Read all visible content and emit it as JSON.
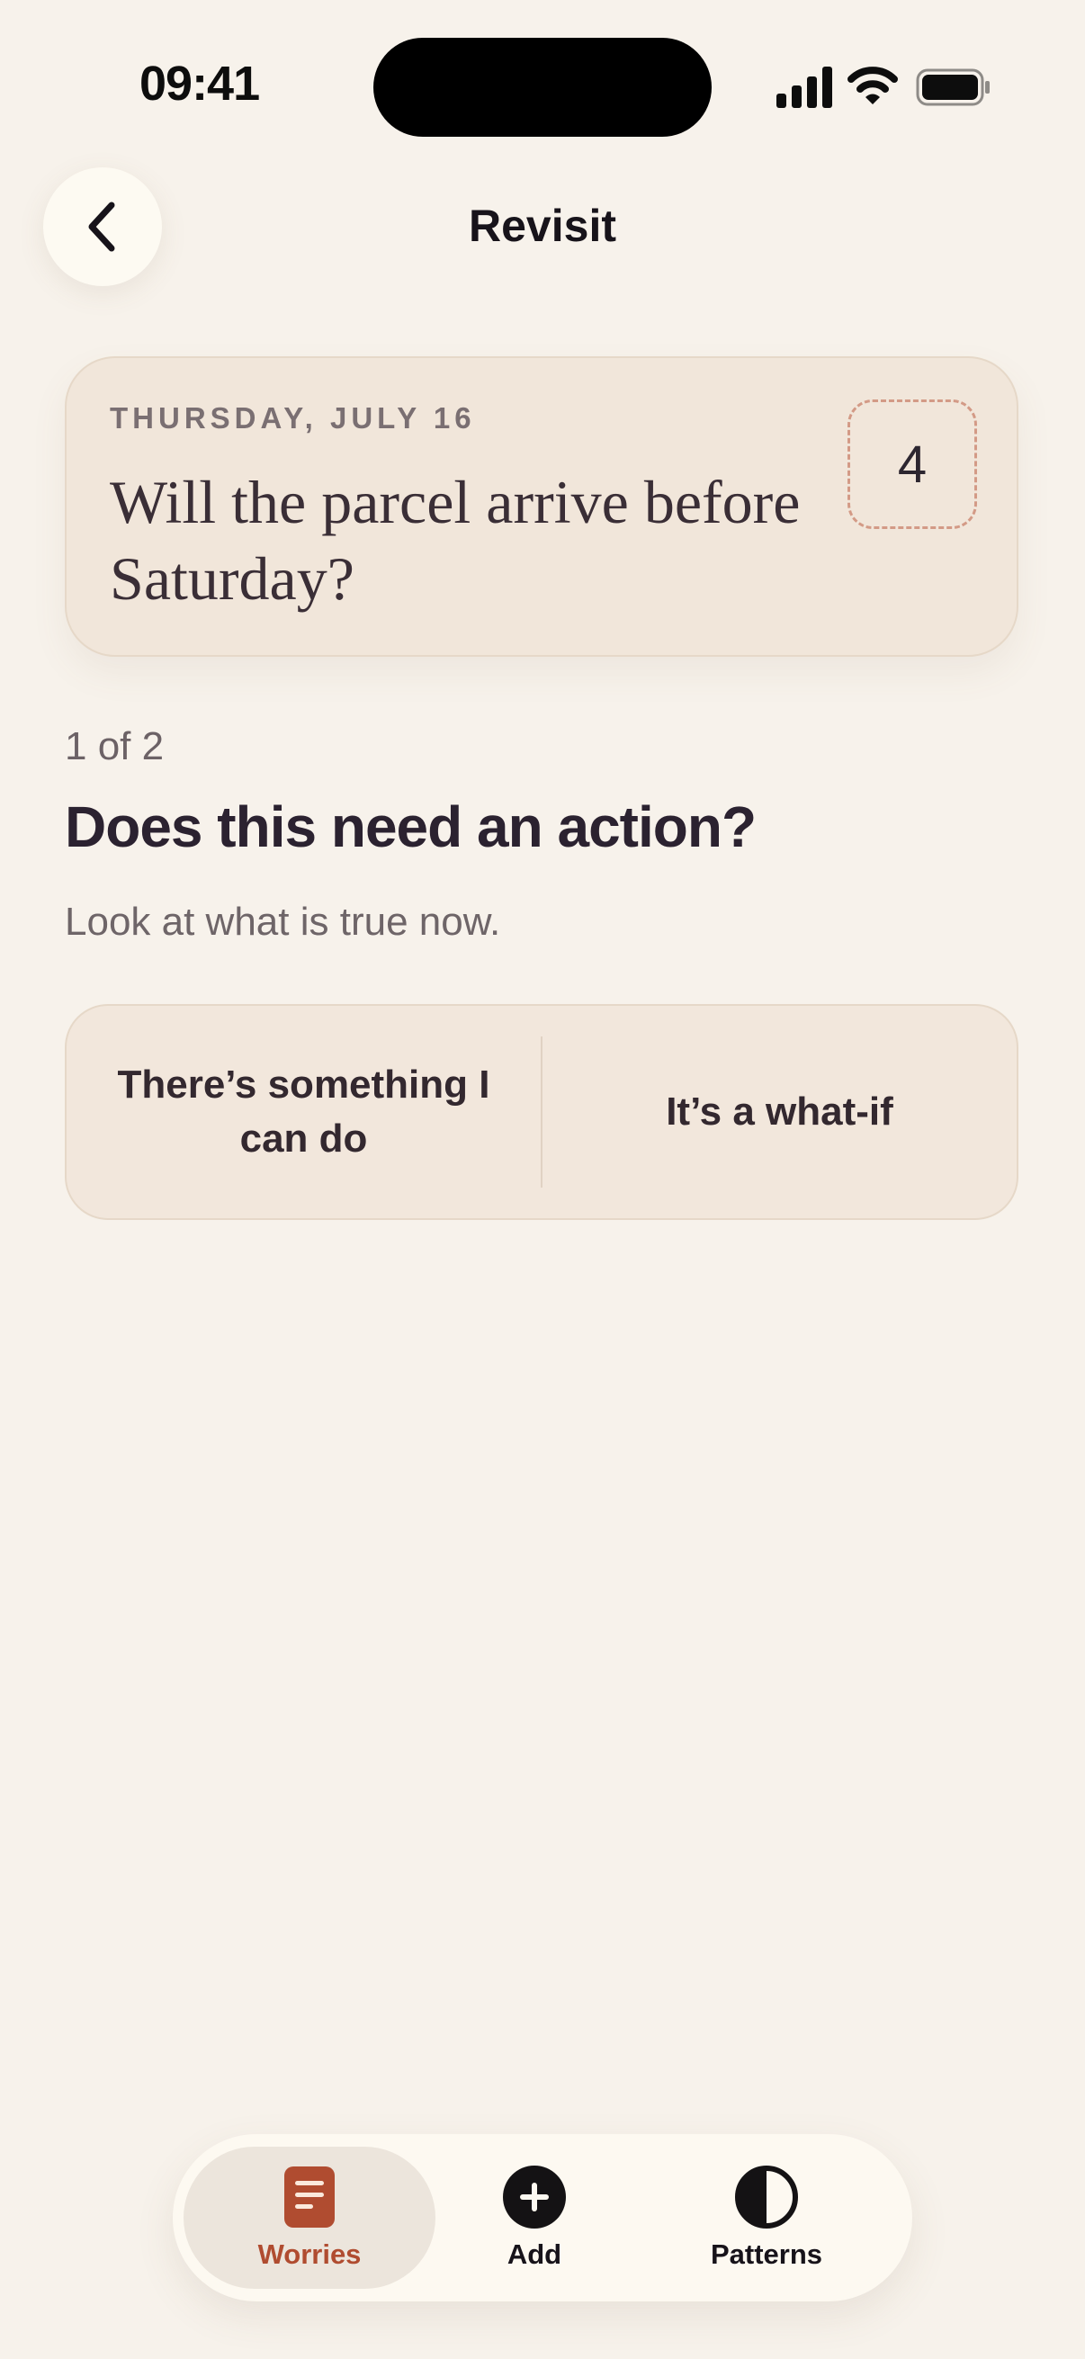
{
  "status_bar": {
    "time": "09:41"
  },
  "nav": {
    "title": "Revisit",
    "back_icon": "chevron-left-icon"
  },
  "worry_card": {
    "date": "THURSDAY, JULY 16",
    "title": "Will the parcel arrive before Saturday?",
    "intensity": "4"
  },
  "prompt": {
    "step": "1 of 2",
    "question": "Does this need an action?",
    "hint": "Look at what is true now."
  },
  "choices": [
    {
      "label": "There’s something I can do"
    },
    {
      "label": "It’s a what-if"
    }
  ],
  "tabbar": {
    "tabs": [
      {
        "label": "Worries",
        "icon": "document-icon",
        "active": true
      },
      {
        "label": "Add",
        "icon": "plus-circle-icon",
        "active": false
      },
      {
        "label": "Patterns",
        "icon": "half-circle-icon",
        "active": false
      }
    ]
  },
  "colors": {
    "background": "#f7f2eb",
    "card": "#f1e6da",
    "accent": "#b04c30",
    "text": "#2c2430"
  }
}
